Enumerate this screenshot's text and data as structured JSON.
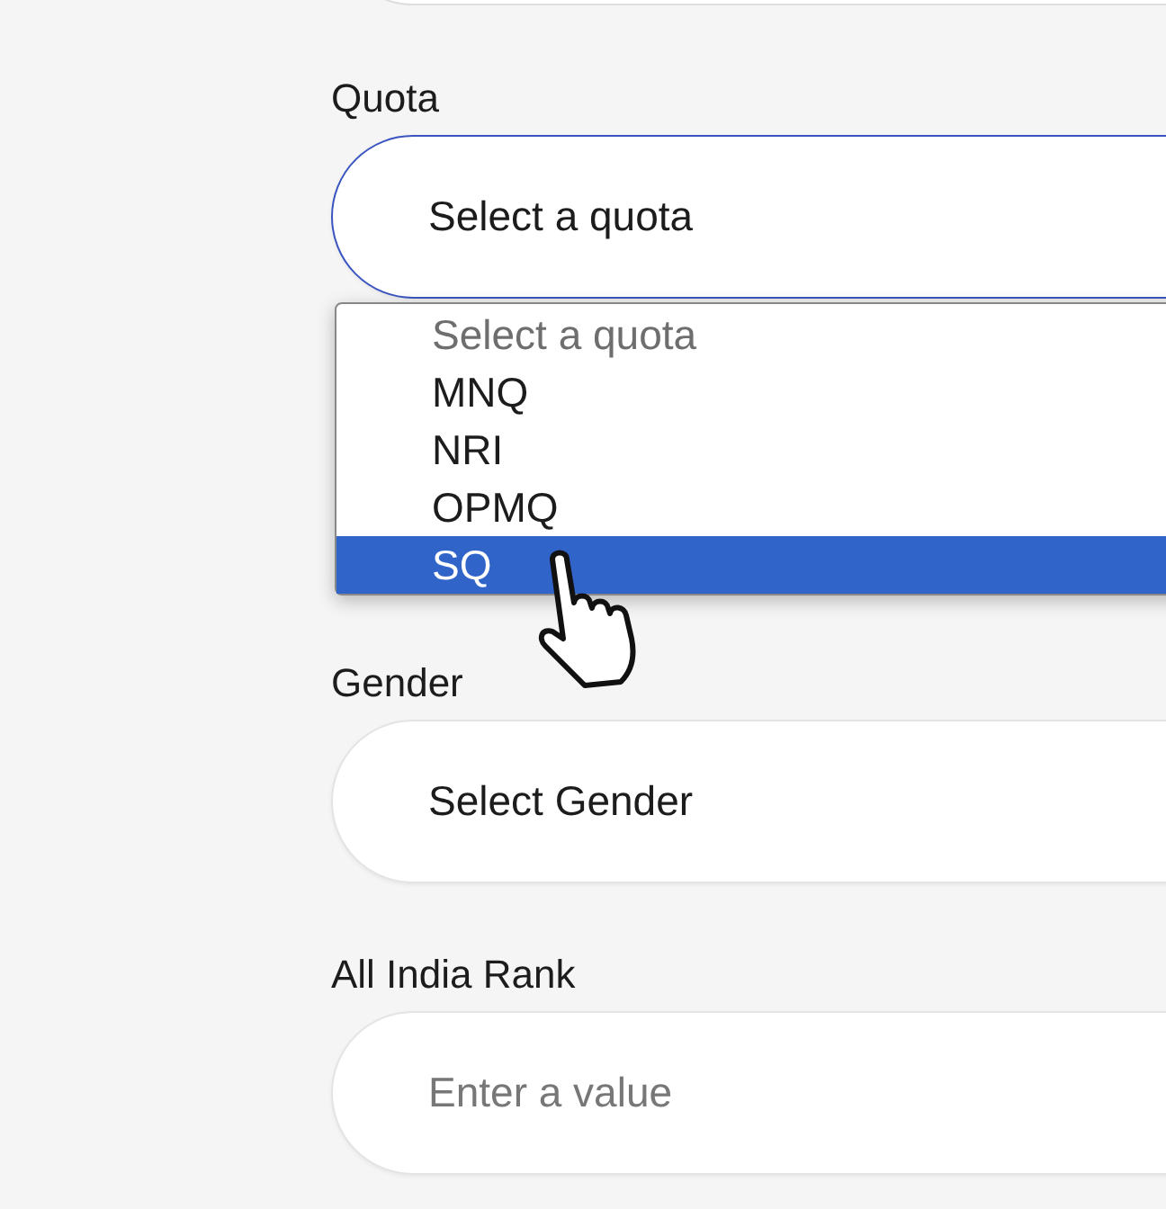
{
  "fields": [
    {
      "label": "Quota",
      "kind": "select",
      "value": "Select a quota",
      "focused": true,
      "options": [
        {
          "label": "Select a quota",
          "disabled": true,
          "highlighted": false
        },
        {
          "label": "MNQ",
          "disabled": false,
          "highlighted": false
        },
        {
          "label": "NRI",
          "disabled": false,
          "highlighted": false
        },
        {
          "label": "OPMQ",
          "disabled": false,
          "highlighted": false
        },
        {
          "label": "SQ",
          "disabled": false,
          "highlighted": true
        }
      ]
    },
    {
      "label": "Gender",
      "kind": "select",
      "value": "Select Gender",
      "focused": false
    },
    {
      "label": "All India Rank",
      "kind": "input",
      "placeholder": "Enter a value",
      "focused": false
    }
  ]
}
